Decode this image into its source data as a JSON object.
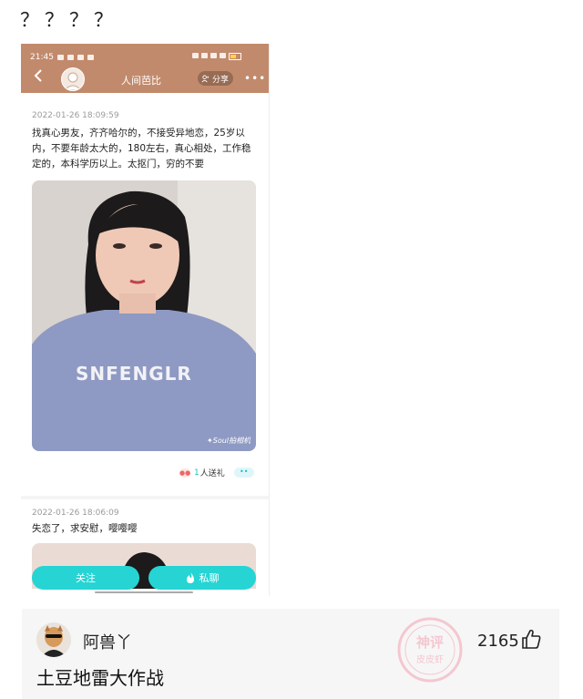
{
  "post": {
    "title": "？？？？"
  },
  "phone": {
    "status": {
      "time": "21:45"
    },
    "header": {
      "profile_name": "人间芭比",
      "share_label": "分享",
      "more_label": "•••"
    },
    "posts": [
      {
        "timestamp": "2022-01-26 18:09:59",
        "text": "找真心男友，齐齐哈尔的，不接受异地恋，25岁以内，不要年龄太大的，180左右，真心相处，工作稳定的，本科学历以上。太抠门，穷的不要",
        "shirt_text": "SNFENGLR",
        "photo_watermark": "✦Soul拍相机",
        "gift_count": "1",
        "gift_label": "人送礼",
        "chat_dots": "••"
      },
      {
        "timestamp": "2022-01-26 18:06:09",
        "text": "失恋了，求安慰，嘤嘤嘤"
      }
    ],
    "actions": {
      "follow_label": "关注",
      "chat_label": "私聊"
    }
  },
  "comment": {
    "username": "阿兽丫",
    "text": "土豆地雷大作战",
    "likes": "2165",
    "watermark_line1": "神评",
    "watermark_line2": "皮皮虾"
  },
  "colors": {
    "header": "#c28a6c",
    "accent": "#26d4d4",
    "card": "#f6f6f6"
  }
}
